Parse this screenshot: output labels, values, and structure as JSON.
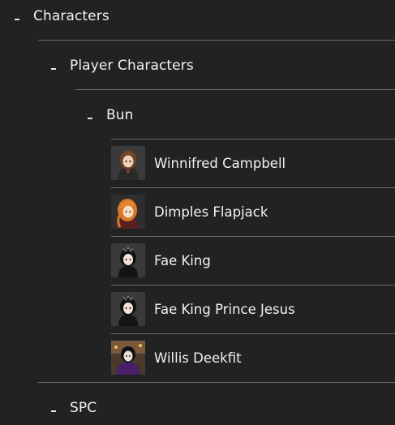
{
  "tree": {
    "characters": {
      "label": "Characters"
    },
    "player_characters": {
      "label": "Player Characters"
    },
    "bun": {
      "label": "Bun",
      "items": [
        {
          "name": "Winnifred Campbell",
          "avatar": "brown-haired-girl-avatar"
        },
        {
          "name": "Dimples Flapjack",
          "avatar": "orange-haired-girl-avatar"
        },
        {
          "name": "Fae King",
          "avatar": "dark-haired-avatar"
        },
        {
          "name": "Fae King Prince Jesus",
          "avatar": "dark-haired-avatar"
        },
        {
          "name": "Willis Deekfit",
          "avatar": "purple-cloaked-avatar"
        }
      ]
    },
    "spc": {
      "label": "SPC"
    }
  },
  "colors": {
    "background": "#222222",
    "text": "#f2f2f2",
    "divider": "#6a6a6a"
  }
}
